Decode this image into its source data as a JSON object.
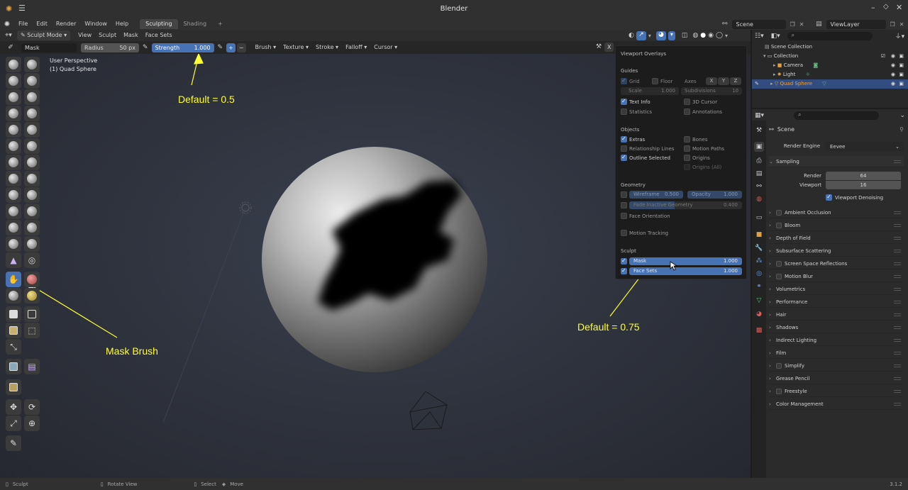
{
  "app": {
    "title": "Blender",
    "version": "3.1.2"
  },
  "menu": {
    "items": [
      "File",
      "Edit",
      "Render",
      "Window",
      "Help"
    ],
    "workspaces": [
      "Sculpting",
      "Shading"
    ],
    "add_workspace": "+",
    "scene_label": "Scene",
    "view_layer_label": "ViewLayer"
  },
  "viewport_header": {
    "mode": "Sculpt Mode",
    "menus": [
      "View",
      "Sculpt",
      "Mask",
      "Face Sets"
    ]
  },
  "tool_header": {
    "brush_name": "Mask",
    "radius_label": "Radius",
    "radius_value": "50 px",
    "strength_label": "Strength",
    "strength_value": "1.000",
    "plus": "+",
    "minus": "−",
    "dropdowns": [
      "Brush",
      "Texture",
      "Stroke",
      "Falloff",
      "Cursor"
    ],
    "x_label": "X"
  },
  "viewport": {
    "perspective": "User Perspective",
    "object_info": "(1) Quad Sphere"
  },
  "annotations": {
    "strength_default": "Default = 0.5",
    "mask_brush": "Mask Brush",
    "mask_default": "Default = 0.75"
  },
  "overlays": {
    "title": "Viewport Overlays",
    "guides": {
      "heading": "Guides",
      "grid": "Grid",
      "floor": "Floor",
      "axes": "Axes",
      "axis_x": "X",
      "axis_y": "Y",
      "axis_z": "Z",
      "scale_label": "Scale",
      "scale_value": "1.000",
      "subdiv_label": "Subdivisions",
      "subdiv_value": "10",
      "text_info": "Text Info",
      "cursor_3d": "3D Cursor",
      "statistics": "Statistics",
      "annotations": "Annotations"
    },
    "objects": {
      "heading": "Objects",
      "extras": "Extras",
      "bones": "Bones",
      "relationship_lines": "Relationship Lines",
      "motion_paths": "Motion Paths",
      "outline_selected": "Outline Selected",
      "origins": "Origins",
      "origins_all": "Origins (All)"
    },
    "geometry": {
      "heading": "Geometry",
      "wireframe_label": "Wireframe",
      "wireframe_value": "0.500",
      "opacity_label": "Opacity",
      "opacity_value": "1.000",
      "fade_label": "Fade Inactive Geometry",
      "fade_value": "0.400",
      "face_orientation": "Face Orientation",
      "motion_tracking": "Motion Tracking"
    },
    "sculpt": {
      "heading": "Sculpt",
      "mask_label": "Mask",
      "mask_value": "1.000",
      "face_sets_label": "Face Sets",
      "face_sets_value": "1.000"
    }
  },
  "outliner": {
    "search_placeholder": "",
    "rows": [
      {
        "label": "Scene Collection"
      },
      {
        "label": "Collection"
      },
      {
        "label": "Camera"
      },
      {
        "label": "Light"
      },
      {
        "label": "Quad Sphere"
      }
    ]
  },
  "properties": {
    "scene_label": "Scene",
    "render_engine_label": "Render Engine",
    "render_engine_value": "Eevee",
    "sampling": "Sampling",
    "render_label": "Render",
    "render_value": "64",
    "viewport_label": "Viewport",
    "viewport_value": "16",
    "viewport_denoising": "Viewport Denoising",
    "panels": [
      {
        "label": "Ambient Occlusion",
        "checkbox": true
      },
      {
        "label": "Bloom",
        "checkbox": true
      },
      {
        "label": "Depth of Field",
        "checkbox": false
      },
      {
        "label": "Subsurface Scattering",
        "checkbox": false
      },
      {
        "label": "Screen Space Reflections",
        "checkbox": true
      },
      {
        "label": "Motion Blur",
        "checkbox": true
      },
      {
        "label": "Volumetrics",
        "checkbox": false
      },
      {
        "label": "Performance",
        "checkbox": false
      },
      {
        "label": "Hair",
        "checkbox": false
      },
      {
        "label": "Shadows",
        "checkbox": false
      },
      {
        "label": "Indirect Lighting",
        "checkbox": false
      },
      {
        "label": "Film",
        "checkbox": false
      },
      {
        "label": "Simplify",
        "checkbox": true
      },
      {
        "label": "Grease Pencil",
        "checkbox": false
      },
      {
        "label": "Freestyle",
        "checkbox": true
      },
      {
        "label": "Color Management",
        "checkbox": false
      }
    ]
  },
  "statusbar": {
    "sculpt": "Sculpt",
    "rotate": "Rotate View",
    "select": "Select",
    "move": "Move"
  },
  "colors": {
    "accent": "#4772b3",
    "annotation": "#ffff33",
    "selected_object": "#f0a030"
  }
}
